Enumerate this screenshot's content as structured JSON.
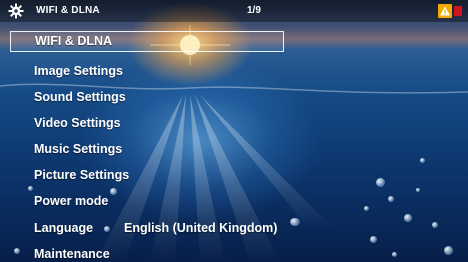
{
  "header": {
    "title": "WIFI & DLNA",
    "page": "1/9"
  },
  "menu": {
    "items": [
      {
        "label": "WIFI & DLNA"
      },
      {
        "label": "Image Settings"
      },
      {
        "label": "Sound Settings"
      },
      {
        "label": "Video Settings"
      },
      {
        "label": "Music Settings"
      },
      {
        "label": "Picture Settings"
      },
      {
        "label": "Power mode"
      },
      {
        "label": "Language",
        "value": "English (United Kingdom)"
      },
      {
        "label": "Maintenance"
      }
    ]
  },
  "colors": {
    "selection_border": "#ffffff",
    "warning": "#f2a900",
    "alert": "#d0131c"
  },
  "icons": {
    "header_left": "gear-icon",
    "header_right": "warning-icon"
  }
}
